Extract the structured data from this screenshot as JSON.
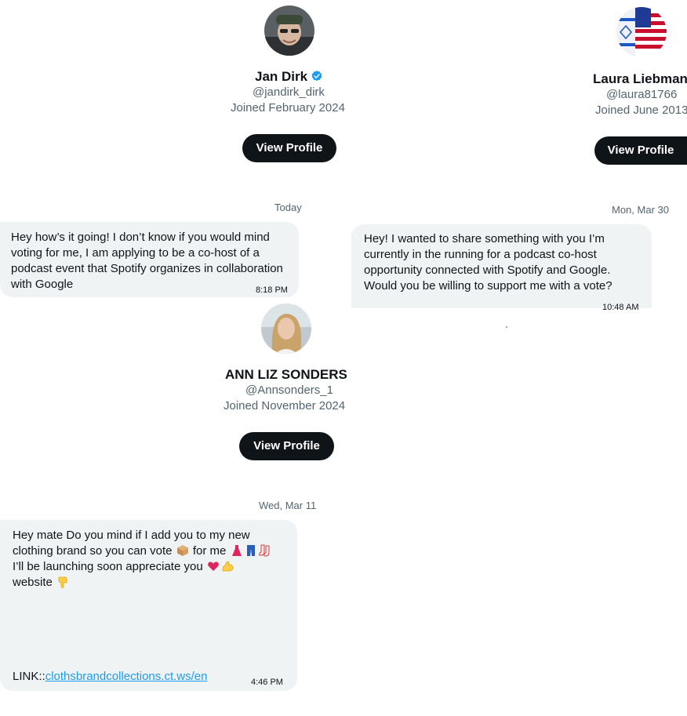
{
  "profiles": {
    "jan": {
      "name": "Jan Dirk",
      "handle": "@jandirk_dirk",
      "joined": "Joined February 2024",
      "button": "View Profile"
    },
    "laura": {
      "name": "Laura Liebman",
      "handle": "@laura81766",
      "joined": "Joined June 2013",
      "button": "View Profile"
    },
    "ann": {
      "name": "ANN LIZ SONDERS",
      "handle": "@Annsonders_1",
      "joined": "Joined November 2024",
      "button": "View Profile"
    }
  },
  "chats": {
    "jan": {
      "date": "Today",
      "message": "Hey how’s it going! I don’t know if you would mind voting for me, I am applying to be a co-host of a podcast event that Spotify organizes in collaboration with Google",
      "time": "8:18 PM"
    },
    "laura": {
      "date": "Mon, Mar 30",
      "message": "Hey! I wanted to share something with you I’m currently in the running for a podcast co-host opportunity connected with Spotify and Google. Would you be willing to support me with a vote?",
      "time": "10:48 AM"
    },
    "ann": {
      "date": "Wed, Mar 11",
      "line1": "Hey mate  Do you mind if I add you to my new",
      "line2a": "clothing brand so you can vote",
      "line2b": "for me",
      "line3": "I’ll be launching soon appreciate you",
      "line4": "website",
      "link_prefix": "LINK::",
      "link_text": "clothsbrandcollections.ct.ws/en",
      "time": "4:46 PM"
    }
  },
  "icons": [
    "verified-badge-icon",
    "box-emoji",
    "dress-emoji",
    "jeans-emoji",
    "socks-emoji",
    "heart-emoji",
    "flexed-biceps-emoji",
    "pointing-down-emoji"
  ],
  "colors": {
    "button_bg": "#0f1419",
    "bubble_bg": "#eff3f4",
    "link": "#1d9bf0",
    "verified": "#1d9bf0",
    "muted": "#536471"
  }
}
